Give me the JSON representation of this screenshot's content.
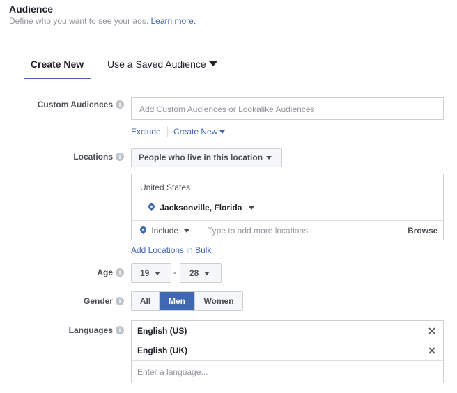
{
  "header": {
    "title": "Audience",
    "subtitle": "Define who you want to see your ads.",
    "learn_more": "Learn more."
  },
  "tabs": [
    {
      "label": "Create New",
      "active": true
    },
    {
      "label": "Use a Saved Audience",
      "active": false
    }
  ],
  "custom_audiences": {
    "label": "Custom Audiences",
    "placeholder": "Add Custom Audiences or Lookalike Audiences",
    "exclude_link": "Exclude",
    "create_new_link": "Create New"
  },
  "locations": {
    "label": "Locations",
    "type_select": "People who live in this location",
    "country": "United States",
    "selected_location": "Jacksonville, Florida",
    "include_select": "Include",
    "search_placeholder": "Type to add more locations",
    "browse_button": "Browse",
    "bulk_link": "Add Locations in Bulk"
  },
  "age": {
    "label": "Age",
    "min": "19",
    "separator": "-",
    "max": "28"
  },
  "gender": {
    "label": "Gender",
    "options": [
      "All",
      "Men",
      "Women"
    ],
    "selected": "Men"
  },
  "languages": {
    "label": "Languages",
    "selected": [
      "English (US)",
      "English (UK)"
    ],
    "placeholder": "Enter a language..."
  },
  "colors": {
    "accent": "#4267b2",
    "text": "#1d2129",
    "muted": "#90949c",
    "border": "#ccd0d5"
  }
}
